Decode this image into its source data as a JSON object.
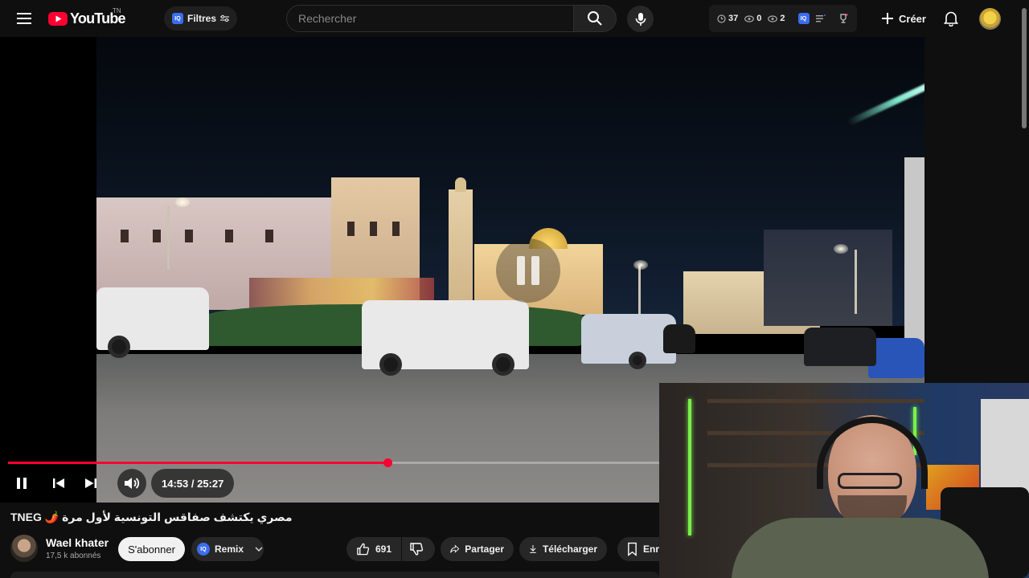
{
  "header": {
    "logo_text": "YouTube",
    "country_code": "TN",
    "filters_label": "Filtres",
    "iq_badge": "IQ",
    "search_placeholder": "Rechercher",
    "extension_stats": [
      {
        "icon": "clock-icon",
        "value": "37"
      },
      {
        "icon": "eye-icon",
        "value": "0"
      },
      {
        "icon": "eye-off-icon",
        "value": "2"
      }
    ],
    "create_label": "Créer"
  },
  "player": {
    "progress_fraction": 0.583,
    "current_time": "14:53",
    "duration": "25:27",
    "time_display": "14:53 / 25:27",
    "state": "paused-overlay"
  },
  "video": {
    "title": "مصري يكتشف صفاقس التونسية لأول مرة 🌶️ TNEG",
    "channel_name": "Wael khater",
    "subscribers": "17,5 k abonnés",
    "subscribe_label": "S'abonner",
    "remix_label": "Remix",
    "like_count": "691",
    "share_label": "Partager",
    "download_label": "Télécharger",
    "save_label_partial": "Enr"
  },
  "colors": {
    "background": "#0f0f0f",
    "accent_red": "#ff0033",
    "pill_bg": "#272727",
    "iq_blue": "#3a6df0"
  }
}
